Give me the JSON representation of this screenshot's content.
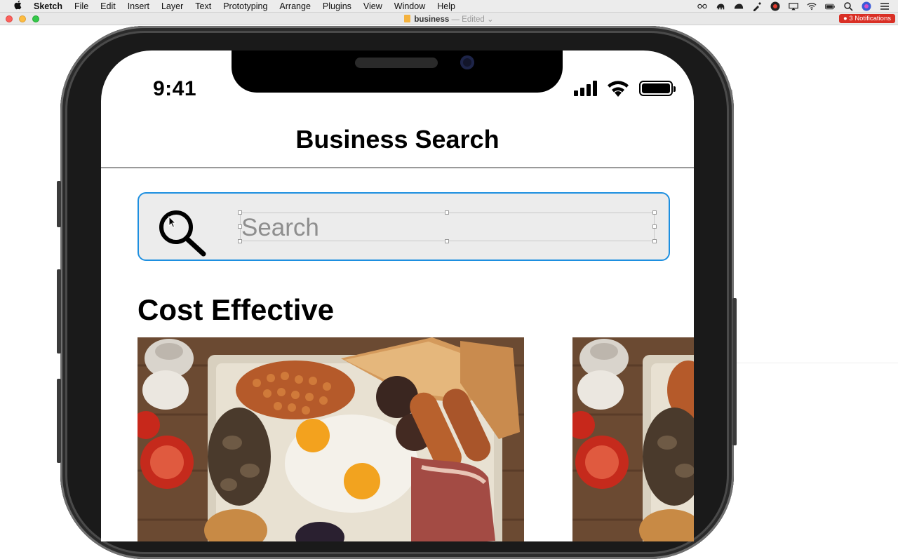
{
  "menubar": {
    "app": "Sketch",
    "items": [
      "File",
      "Edit",
      "Insert",
      "Layer",
      "Text",
      "Prototyping",
      "Arrange",
      "Plugins",
      "View",
      "Window",
      "Help"
    ]
  },
  "window": {
    "doc_name": "business",
    "doc_status": "— Edited",
    "notifications": "3 Notifications"
  },
  "phone": {
    "status": {
      "time": "9:41"
    },
    "nav": {
      "title": "Business Search"
    },
    "search": {
      "placeholder": "Search"
    },
    "section": {
      "title": "Cost Effective"
    }
  },
  "colors": {
    "accent_border": "#1d8fe0",
    "search_bg": "#ececec",
    "notification_badge": "#d92f25"
  },
  "icons": {
    "apple": "apple-icon",
    "search": "magnifier-icon",
    "wifi": "wifi-icon",
    "signal": "cellular-signal-icon",
    "battery": "battery-icon"
  }
}
